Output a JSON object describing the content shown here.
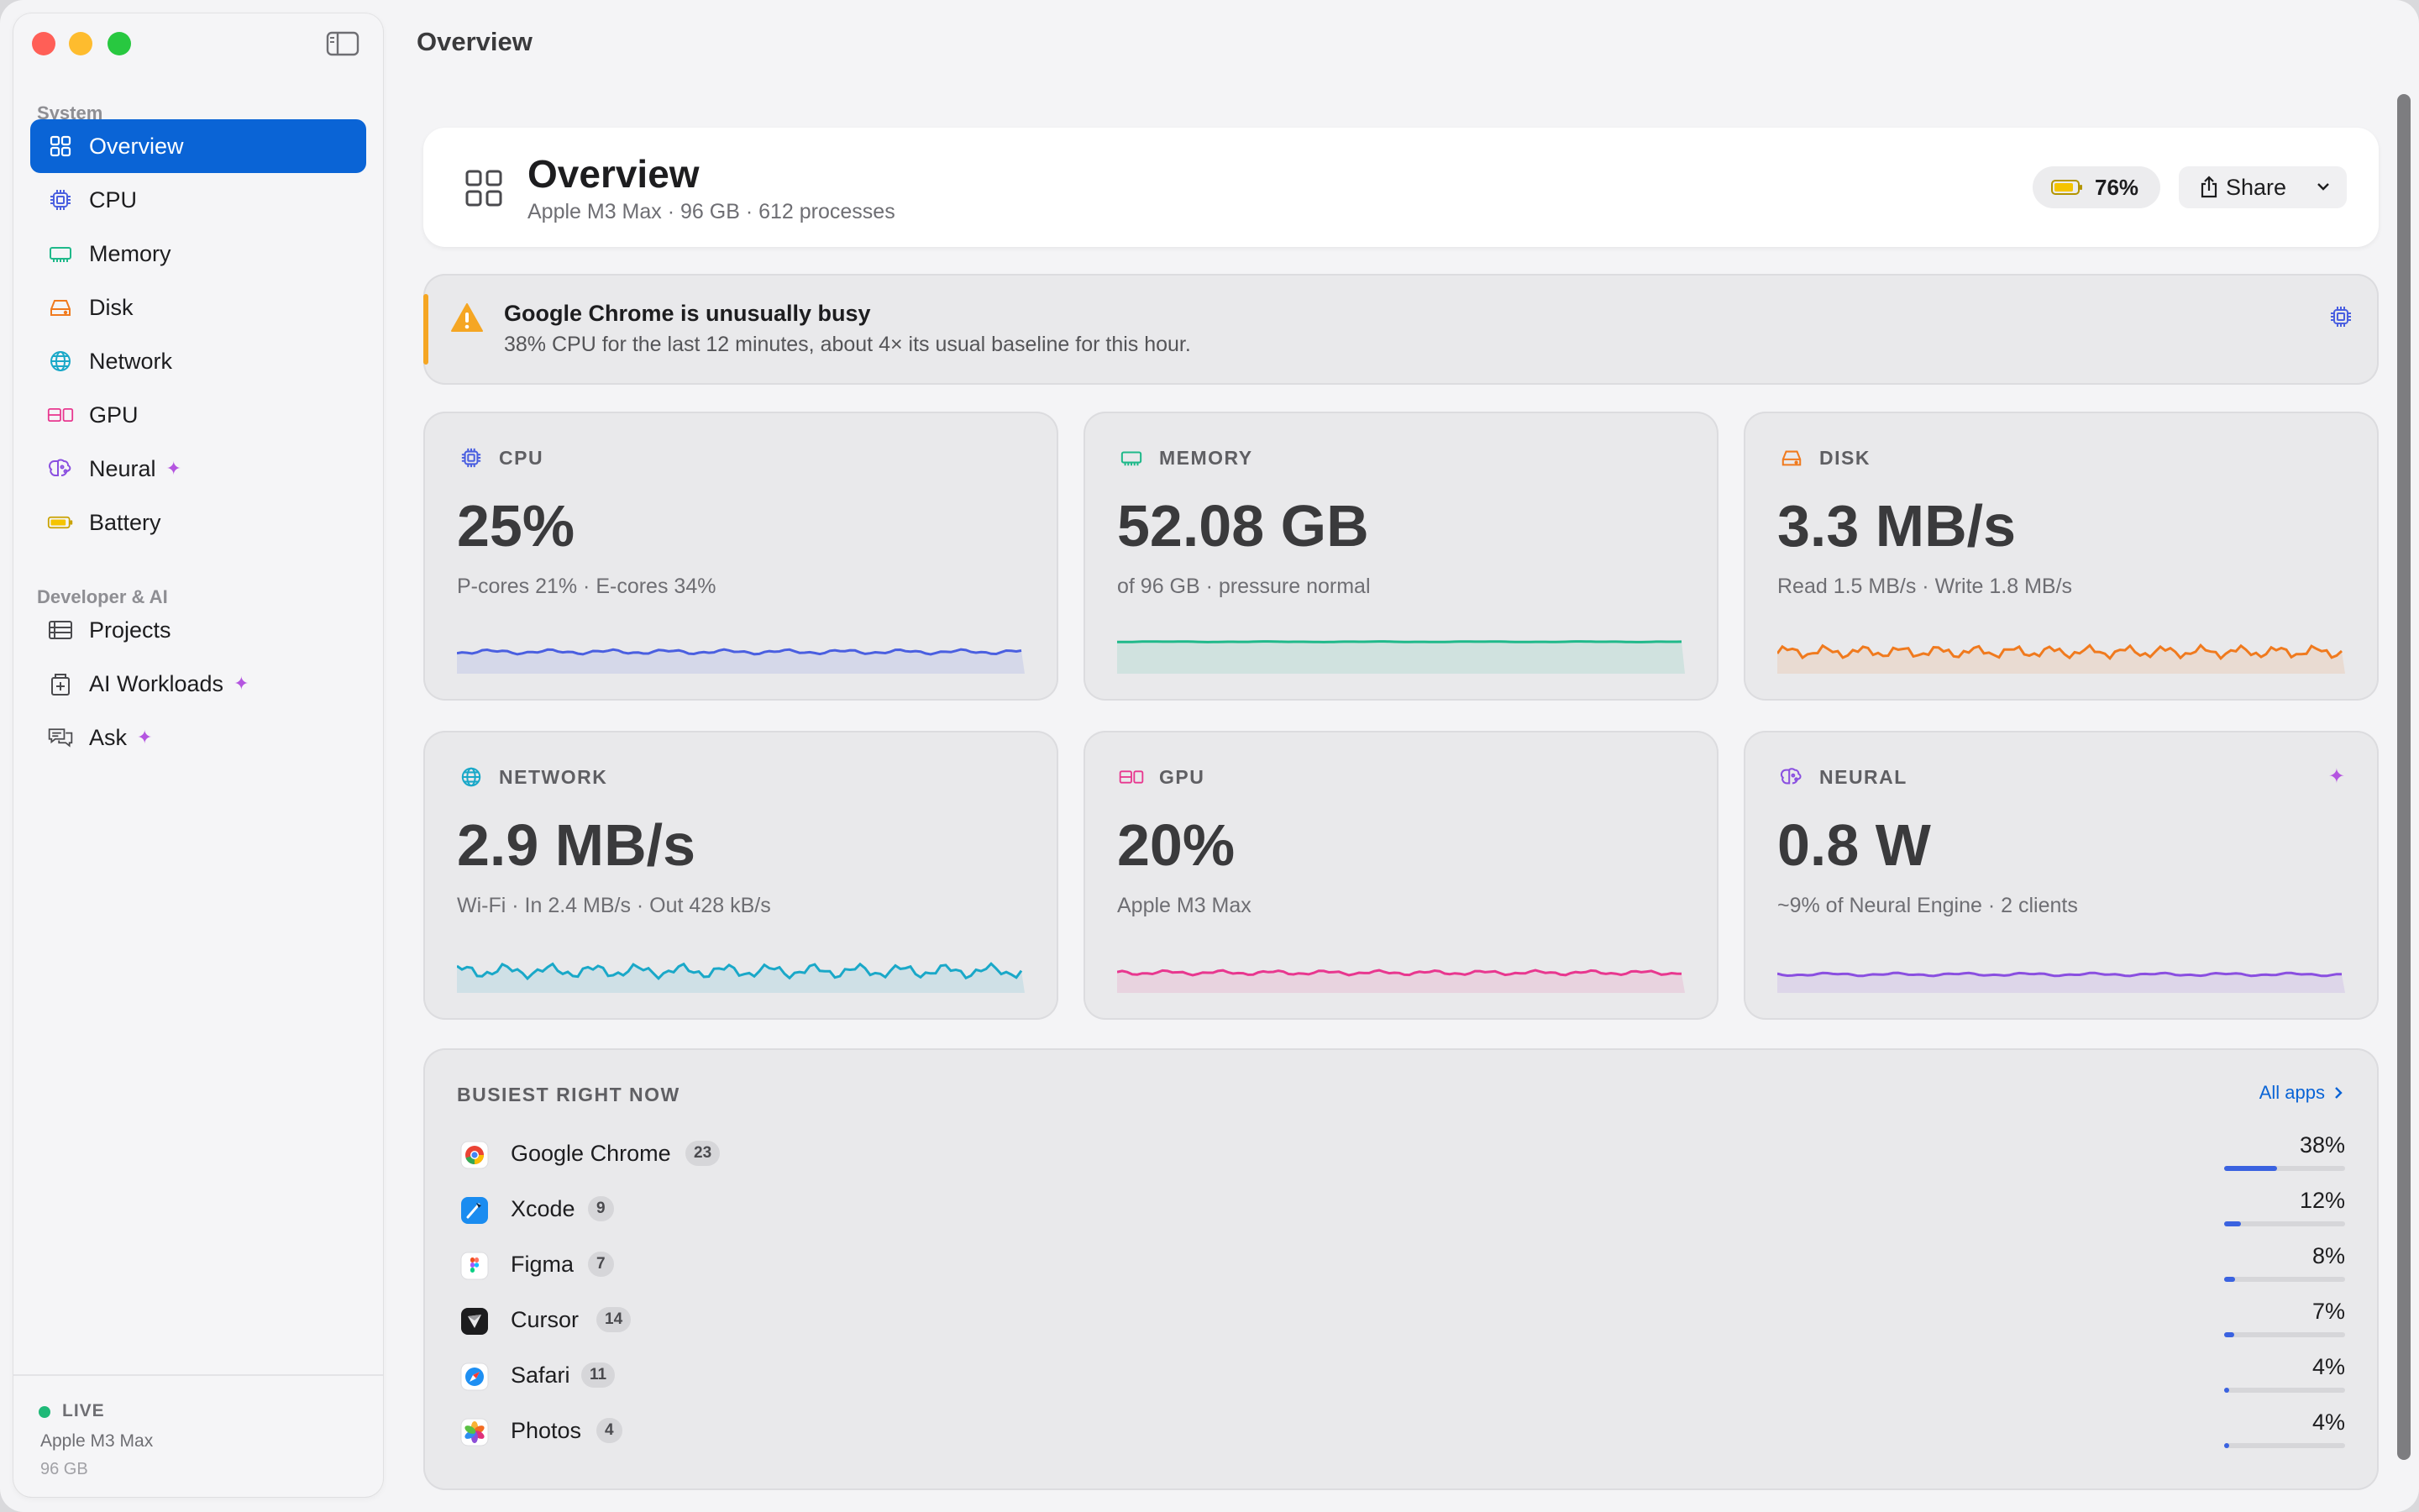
{
  "window": {
    "title": "Overview"
  },
  "sidebar": {
    "section_system": "System",
    "section_dev": "Developer & AI",
    "items": [
      {
        "label": "Overview",
        "icon": "grid-icon",
        "active": true
      },
      {
        "label": "CPU",
        "icon": "cpu-icon"
      },
      {
        "label": "Memory",
        "icon": "memory-icon"
      },
      {
        "label": "Disk",
        "icon": "disk-icon"
      },
      {
        "label": "Network",
        "icon": "globe-icon"
      },
      {
        "label": "GPU",
        "icon": "gpu-icon"
      },
      {
        "label": "Neural",
        "icon": "brain-icon",
        "sparkle": true
      },
      {
        "label": "Battery",
        "icon": "battery-icon"
      }
    ],
    "dev_items": [
      {
        "label": "Projects",
        "icon": "projects-icon"
      },
      {
        "label": "AI Workloads",
        "icon": "ai-workloads-icon",
        "sparkle": true
      },
      {
        "label": "Ask",
        "icon": "chat-icon",
        "sparkle": true
      }
    ],
    "sparkle": "✦",
    "footer": {
      "status": "LIVE",
      "chip": "Apple M3 Max",
      "memory": "96 GB"
    }
  },
  "header": {
    "title": "Overview",
    "subtitle": "Apple M3 Max · 96 GB · 612 processes",
    "battery": "76%",
    "share": "Share"
  },
  "alert": {
    "title": "Google Chrome is unusually busy",
    "body": "38% CPU for the last 12 minutes, about 4× its usual baseline for this hour."
  },
  "metrics": [
    {
      "label": "CPU",
      "value": "25%",
      "sub": "P-cores 21% · E-cores 34%",
      "color": "#4a5fe0"
    },
    {
      "label": "MEMORY",
      "value": "52.08 GB",
      "sub": "of 96 GB · pressure normal",
      "color": "#1fb98a"
    },
    {
      "label": "DISK",
      "value": "3.3 MB/s",
      "sub": "Read 1.5 MB/s · Write 1.8 MB/s",
      "color": "#f07a1e"
    },
    {
      "label": "NETWORK",
      "value": "2.9 MB/s",
      "sub": "Wi-Fi · In 2.4 MB/s · Out 428 kB/s",
      "color": "#1aa8c8"
    },
    {
      "label": "GPU",
      "value": "20%",
      "sub": "Apple M3 Max",
      "color": "#e8378f"
    },
    {
      "label": "NEURAL",
      "value": "0.8 W",
      "sub": "~9% of Neural Engine · 2 clients",
      "color": "#8a4fe0"
    }
  ],
  "busiest": {
    "label": "BUSIEST RIGHT NOW",
    "all_apps": "All apps",
    "apps": [
      {
        "name": "Google Chrome",
        "count": "23",
        "pct": "38%",
        "fraction": 0.44,
        "icon": "chrome-icon"
      },
      {
        "name": "Xcode",
        "count": "9",
        "pct": "12%",
        "fraction": 0.14,
        "icon": "xcode-icon"
      },
      {
        "name": "Figma",
        "count": "7",
        "pct": "8%",
        "fraction": 0.09,
        "icon": "figma-icon"
      },
      {
        "name": "Cursor",
        "count": "14",
        "pct": "7%",
        "fraction": 0.08,
        "icon": "cursor-icon"
      },
      {
        "name": "Safari",
        "count": "11",
        "pct": "4%",
        "fraction": 0.04,
        "icon": "safari-icon"
      },
      {
        "name": "Photos",
        "count": "4",
        "pct": "4%",
        "fraction": 0.04,
        "icon": "photos-icon"
      }
    ]
  }
}
